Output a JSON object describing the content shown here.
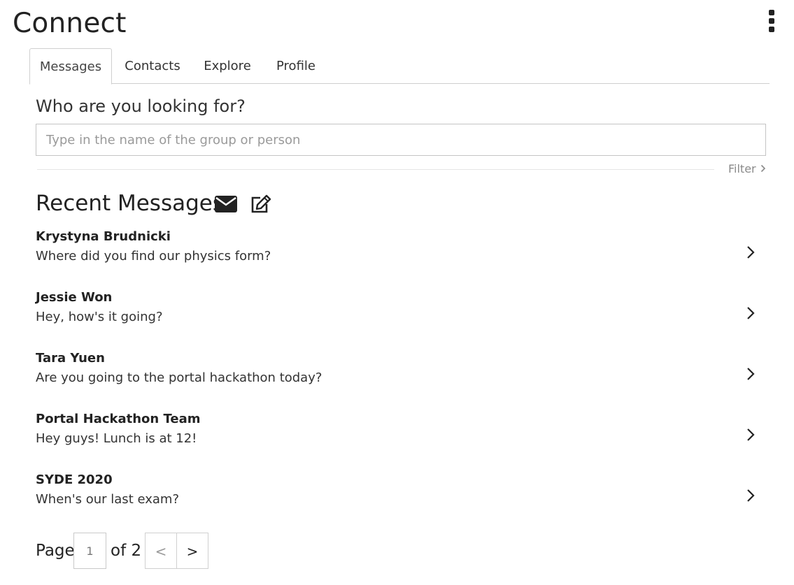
{
  "app": {
    "title": "Connect"
  },
  "tabs": [
    {
      "label": "Messages",
      "active": true
    },
    {
      "label": "Contacts",
      "active": false
    },
    {
      "label": "Explore",
      "active": false
    },
    {
      "label": "Profile",
      "active": false
    }
  ],
  "search": {
    "label": "Who are you looking for?",
    "placeholder": "Type in the name of the group or person",
    "value": "",
    "filter_label": "Filter"
  },
  "recent": {
    "title": "Recent Messages",
    "icons": [
      "envelope-icon",
      "compose-icon"
    ],
    "messages": [
      {
        "name": "Krystyna Brudnicki",
        "text": "Where did you find our physics form?"
      },
      {
        "name": "Jessie Won",
        "text": "Hey, how's it going?"
      },
      {
        "name": "Tara Yuen",
        "text": "Are you going to the portal hackathon today?"
      },
      {
        "name": "Portal Hackathon Team",
        "text": "Hey guys! Lunch is at 12!"
      },
      {
        "name": "SYDE 2020",
        "text": "When's our last exam?"
      }
    ]
  },
  "pagination": {
    "page_label": "Page",
    "current_page": "1",
    "of_label": "of 2",
    "prev_label": "<",
    "next_label": ">"
  },
  "colors": {
    "text": "#222222",
    "border": "#cfcfcf",
    "muted": "#8a8a8a"
  }
}
